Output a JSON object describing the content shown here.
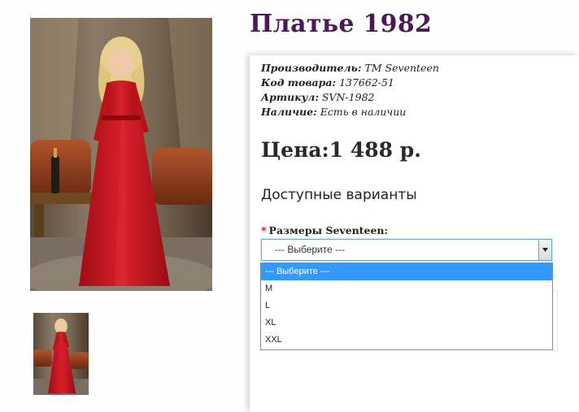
{
  "product": {
    "title": "Платье 1982",
    "meta": [
      {
        "label": "Производитель:",
        "value": "ТМ Seventeen"
      },
      {
        "label": "Код товара:",
        "value": "137662-51"
      },
      {
        "label": "Артикул:",
        "value": "SVN-1982"
      },
      {
        "label": "Наличие:",
        "value": "Есть в наличии"
      }
    ],
    "price": "Цена:1 488 р."
  },
  "variants": {
    "title": "Доступные варианты",
    "size_label": "Размеры Seventeen:",
    "required_mark": "*",
    "selected": "--- Выберите ---",
    "options": [
      "--- Выберите ---",
      "M",
      "L",
      "XL",
      "XXL"
    ]
  },
  "colors": {
    "title": "#4a1a55",
    "dress": "#c8141c",
    "highlight": "#3399ff"
  }
}
